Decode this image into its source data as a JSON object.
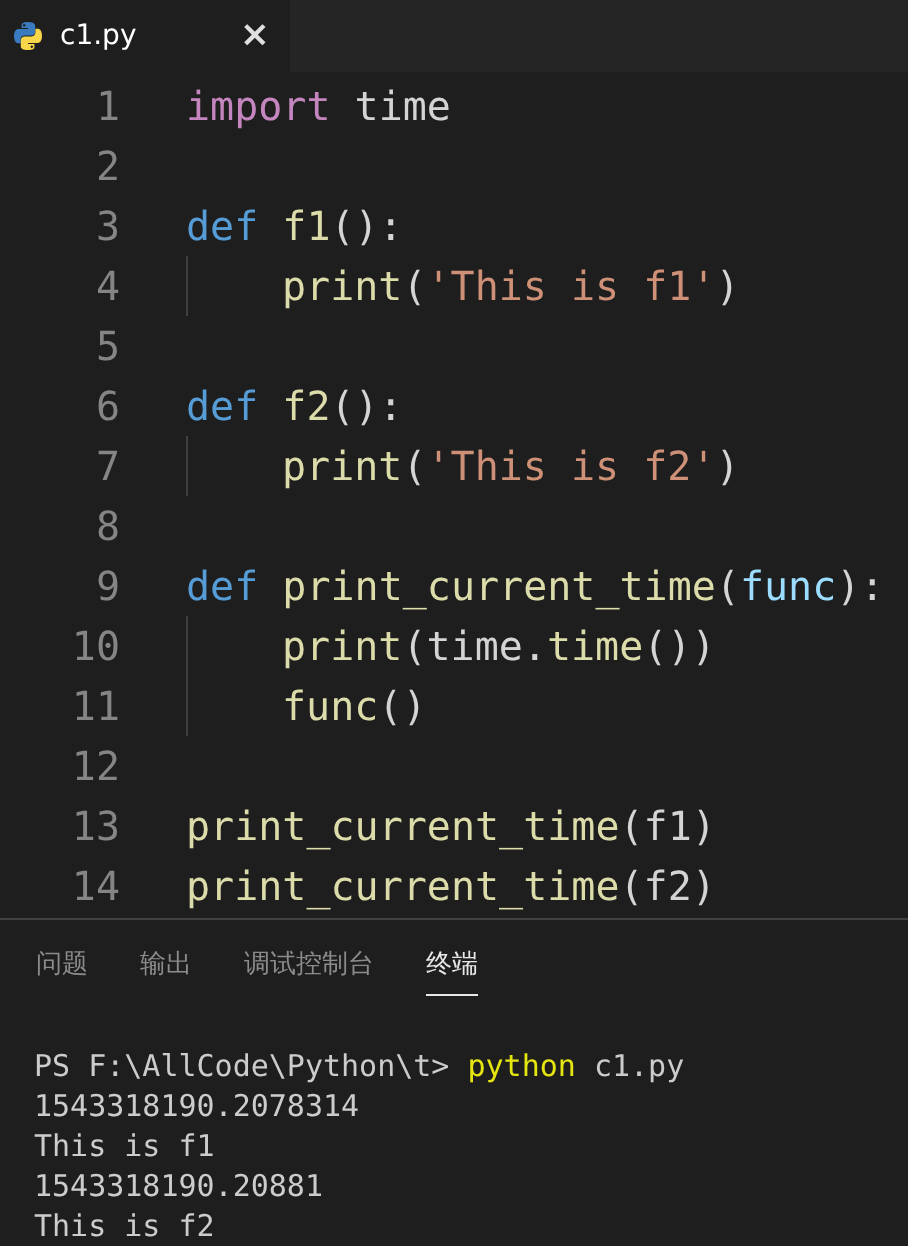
{
  "tabs": [
    {
      "label": "c1.py",
      "selected": true,
      "close": "×"
    }
  ],
  "editor": {
    "lines": [
      {
        "number": "1",
        "indented": false,
        "tokens": [
          {
            "text": "import",
            "kind": "control"
          },
          {
            "text": " time",
            "kind": "plain"
          }
        ]
      },
      {
        "number": "2",
        "indented": false
      },
      {
        "number": "3",
        "indented": false,
        "tokens": [
          {
            "text": "def",
            "kind": "keyword"
          },
          {
            "text": " f1",
            "kind": "function"
          },
          {
            "text": "():",
            "kind": "plain"
          }
        ]
      },
      {
        "number": "4",
        "indented": true,
        "tokens": [
          {
            "text": "print",
            "kind": "function"
          },
          {
            "text": "(",
            "kind": "plain"
          },
          {
            "text": "'This is f1'",
            "kind": "string"
          },
          {
            "text": ")",
            "kind": "plain"
          }
        ]
      },
      {
        "number": "5",
        "indented": false
      },
      {
        "number": "6",
        "indented": false,
        "tokens": [
          {
            "text": "def",
            "kind": "keyword"
          },
          {
            "text": " f2",
            "kind": "function"
          },
          {
            "text": "():",
            "kind": "plain"
          }
        ]
      },
      {
        "number": "7",
        "indented": true,
        "tokens": [
          {
            "text": "print",
            "kind": "function"
          },
          {
            "text": "(",
            "kind": "plain"
          },
          {
            "text": "'This is f2'",
            "kind": "string"
          },
          {
            "text": ")",
            "kind": "plain"
          }
        ]
      },
      {
        "number": "8",
        "indented": false
      },
      {
        "number": "9",
        "indented": false,
        "tokens": [
          {
            "text": "def",
            "kind": "keyword"
          },
          {
            "text": " print_current_time",
            "kind": "function"
          },
          {
            "text": "(",
            "kind": "plain"
          },
          {
            "text": "func",
            "kind": "parameter"
          },
          {
            "text": "):",
            "kind": "plain"
          }
        ]
      },
      {
        "number": "10",
        "indented": true,
        "tokens": [
          {
            "text": "print",
            "kind": "function"
          },
          {
            "text": "(time.",
            "kind": "plain"
          },
          {
            "text": "time",
            "kind": "function"
          },
          {
            "text": "())",
            "kind": "plain"
          }
        ]
      },
      {
        "number": "11",
        "indented": true,
        "tokens": [
          {
            "text": "func",
            "kind": "function"
          },
          {
            "text": "()",
            "kind": "plain"
          }
        ]
      },
      {
        "number": "12",
        "indented": false
      },
      {
        "number": "13",
        "indented": false,
        "tokens": [
          {
            "text": "print_current_time",
            "kind": "function"
          },
          {
            "text": "(f1)",
            "kind": "plain"
          }
        ]
      },
      {
        "number": "14",
        "indented": false,
        "tokens": [
          {
            "text": "print_current_time",
            "kind": "function"
          },
          {
            "text": "(f2)",
            "kind": "plain"
          }
        ]
      }
    ]
  },
  "panel": {
    "tabs": [
      {
        "label": "问题",
        "selected": false
      },
      {
        "label": "输出",
        "selected": false
      },
      {
        "label": "调试控制台",
        "selected": false
      },
      {
        "label": "终端",
        "selected": true
      }
    ],
    "terminal": [
      {
        "parts": [
          {
            "text": "PS F:\\AllCode\\Python\\t> ",
            "kind": "plain"
          },
          {
            "text": "python",
            "kind": "command"
          },
          {
            "text": " c1.py",
            "kind": "plain"
          }
        ]
      },
      {
        "parts": [
          {
            "text": "1543318190.2078314",
            "kind": "plain"
          }
        ]
      },
      {
        "parts": [
          {
            "text": "This is f1",
            "kind": "plain"
          }
        ]
      },
      {
        "parts": [
          {
            "text": "1543318190.20881",
            "kind": "plain"
          }
        ]
      },
      {
        "parts": [
          {
            "text": "This is f2",
            "kind": "plain"
          }
        ]
      }
    ]
  }
}
